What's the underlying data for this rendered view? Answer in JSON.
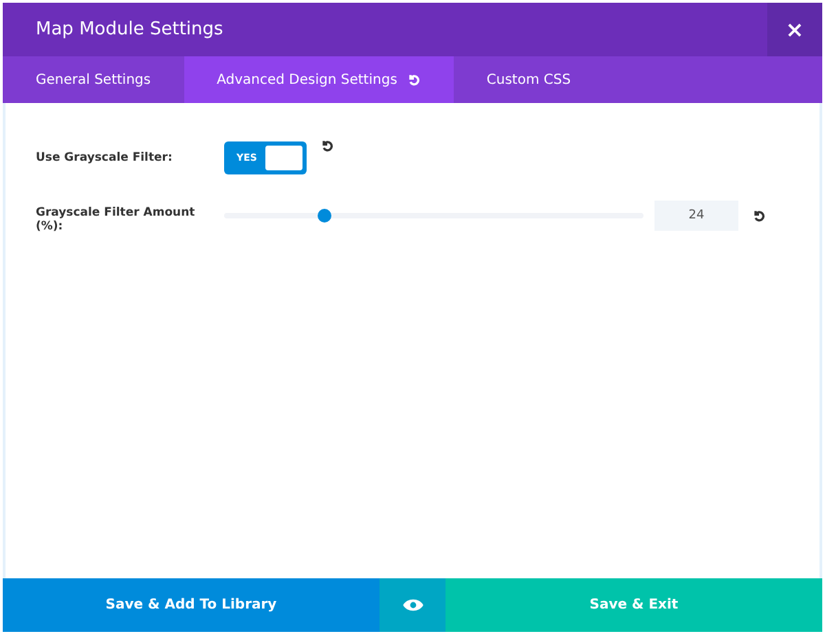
{
  "window": {
    "title": "Map Module Settings",
    "close": "×"
  },
  "tabs": [
    {
      "label": "General Settings",
      "selected": false,
      "reset": false
    },
    {
      "label": "Advanced Design Settings",
      "selected": true,
      "reset": true
    },
    {
      "label": "Custom CSS",
      "selected": false,
      "reset": false
    }
  ],
  "settings": [
    {
      "kind": "toggle",
      "label": "Use Grayscale Filter:",
      "on": true,
      "on_text": "YES"
    },
    {
      "kind": "slider",
      "label": "Grayscale Filter Amount (%):",
      "level": 0.24,
      "value": "24"
    }
  ],
  "footer": {
    "library_button": "Save & Add To Library",
    "exit_button": "Save & Exit"
  }
}
